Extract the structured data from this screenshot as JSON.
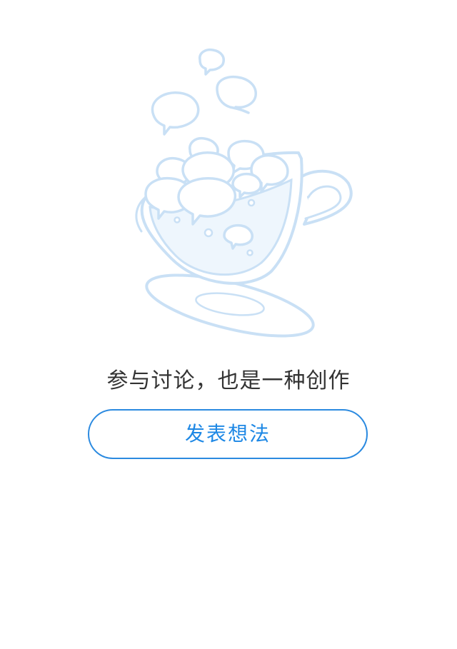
{
  "empty_state": {
    "illustration_icon": "coffee-cup-speech-bubbles-icon",
    "message": "参与讨论，也是一种创作",
    "button_label": "发表想法"
  },
  "colors": {
    "illustration_stroke": "#c9e0f5",
    "illustration_fill": "#eef6fd",
    "message_text": "#333333",
    "button_accent": "#1e88e5",
    "background": "#ffffff"
  }
}
